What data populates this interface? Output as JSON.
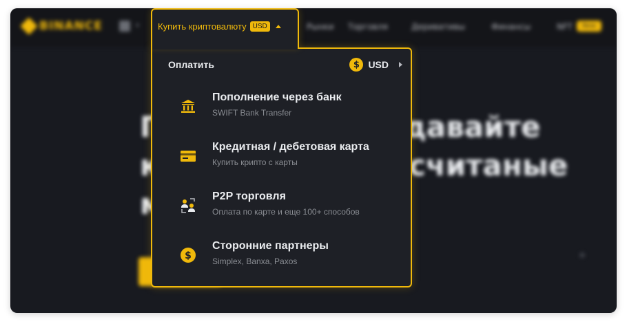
{
  "brand": {
    "name": "BINANCE"
  },
  "nav": {
    "active_tab": {
      "label": "Купить криптовалюту",
      "badge": "USD"
    },
    "items": [
      "Рынки",
      "Торговля",
      "Деривативы",
      "Финансы",
      "NFT"
    ],
    "nft_badge": "New"
  },
  "dropdown": {
    "pay_label": "Оплатить",
    "currency": {
      "symbol": "$",
      "code": "USD"
    },
    "options": [
      {
        "title": "Пополнение через банк",
        "desc": "SWIFT Bank Transfer",
        "icon": "bank-icon"
      },
      {
        "title": "Кредитная / дебетовая карта",
        "desc": "Купить крипто с карты",
        "icon": "credit-card-icon"
      },
      {
        "title": "P2P торговля",
        "desc": "Оплата по карте и еще 100+ способов",
        "icon": "p2p-icon"
      },
      {
        "title": "Сторонние партнеры",
        "desc": "Simplex, Banxa, Paxos",
        "icon": "dollar-coin-icon"
      }
    ]
  },
  "hero": {
    "line_a1": "П",
    "line_a2": "давайте",
    "line_b1": "к",
    "line_b2": "считаные",
    "line_c1": "м"
  },
  "colors": {
    "accent": "#f0b90b",
    "panel_bg": "#1e2026",
    "page_bg": "#181a20"
  }
}
